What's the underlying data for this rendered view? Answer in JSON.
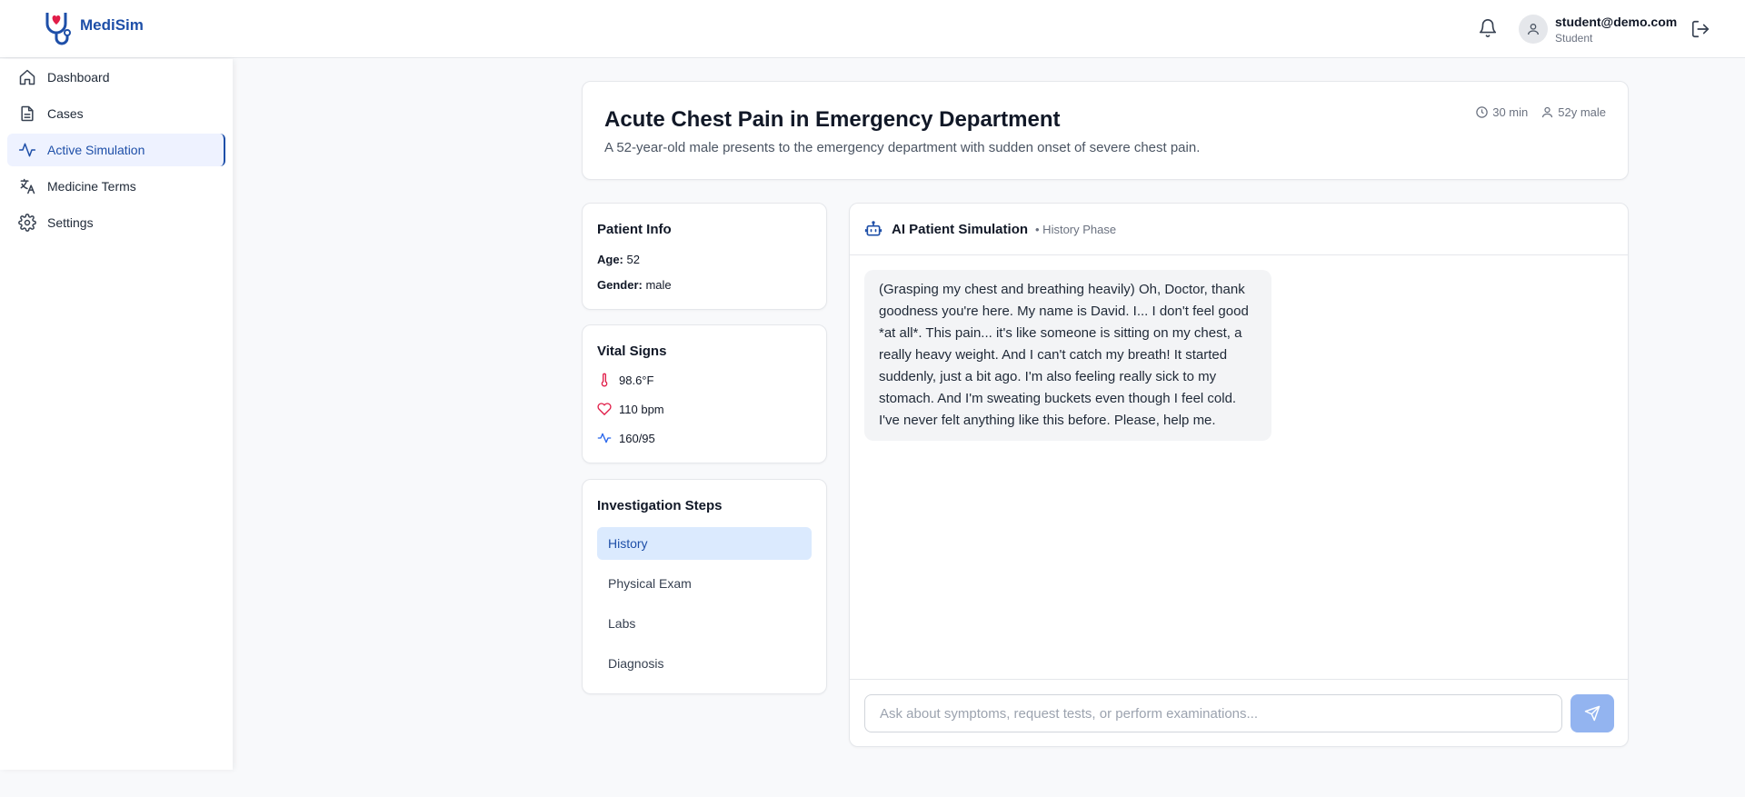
{
  "app": {
    "name": "MediSim"
  },
  "user": {
    "email": "student@demo.com",
    "role": "Student"
  },
  "sidebar": {
    "items": [
      {
        "label": "Dashboard",
        "icon": "home-icon"
      },
      {
        "label": "Cases",
        "icon": "file-icon"
      },
      {
        "label": "Active Simulation",
        "icon": "activity-icon",
        "active": true
      },
      {
        "label": "Medicine Terms",
        "icon": "translate-icon"
      },
      {
        "label": "Settings",
        "icon": "gear-icon"
      }
    ]
  },
  "case": {
    "title": "Acute Chest Pain in Emergency Department",
    "description": "A 52-year-old male presents to the emergency department with sudden onset of severe chest pain.",
    "duration": "30 min",
    "patient_summary": "52y male"
  },
  "patient_info": {
    "title": "Patient Info",
    "age_label": "Age:",
    "age": "52",
    "gender_label": "Gender:",
    "gender": "male"
  },
  "vitals": {
    "title": "Vital Signs",
    "temperature": "98.6°F",
    "heart_rate": "110 bpm",
    "blood_pressure": "160/95"
  },
  "steps": {
    "title": "Investigation Steps",
    "items": [
      "History",
      "Physical Exam",
      "Labs",
      "Diagnosis"
    ],
    "active": "History"
  },
  "chat": {
    "title": "AI Patient Simulation",
    "phase": "• History Phase",
    "messages": [
      "(Grasping my chest and breathing heavily) Oh, Doctor, thank goodness you're here. My name is David. I... I don't feel good *at all*. This pain... it's like someone is sitting on my chest, a really heavy weight. And I can't catch my breath! It started suddenly, just a bit ago. I'm also feeling really sick to my stomach. And I'm sweating buckets even though I feel cold. I've never felt anything like this before. Please, help me."
    ],
    "input_placeholder": "Ask about symptoms, request tests, or perform examinations..."
  },
  "colors": {
    "accent": "#1e4fa8",
    "active_bg": "#dbeafe",
    "send_button": "#93b4f0",
    "heart": "#e11d48"
  }
}
